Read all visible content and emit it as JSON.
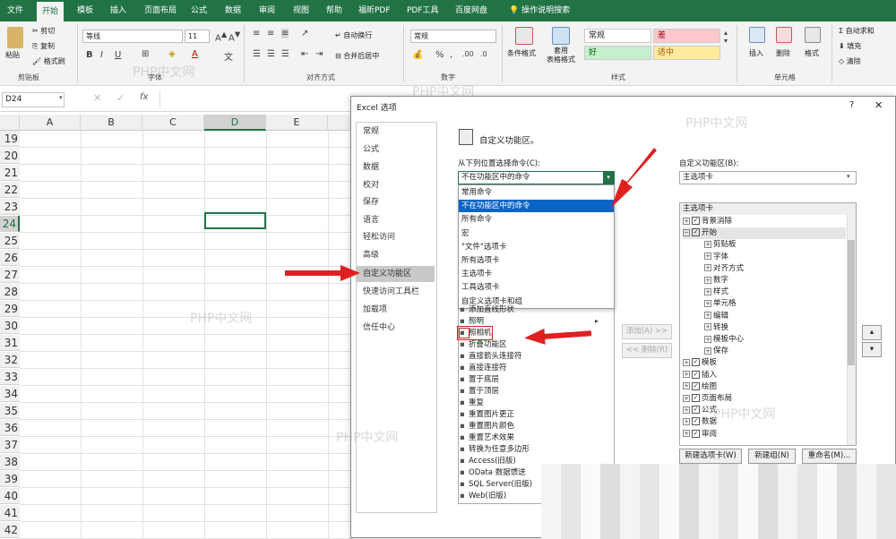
{
  "tabs": [
    "文件",
    "开始",
    "模板",
    "插入",
    "页面布局",
    "公式",
    "数据",
    "审阅",
    "视图",
    "帮助",
    "福昕PDF",
    "PDF工具",
    "百度网盘",
    "操作说明搜索"
  ],
  "ribbon": {
    "clipboard": {
      "paste": "粘贴",
      "cut": "剪切",
      "copy": "复制",
      "format_painter": "格式刷",
      "label": "剪贴板"
    },
    "font": {
      "name": "等线",
      "size": "11",
      "label": "字体"
    },
    "alignment": {
      "wrap": "自动换行",
      "merge": "合并后居中",
      "label": "对齐方式"
    },
    "number": {
      "format": "常规",
      "label": "数字"
    },
    "styles": {
      "cond": "条件格式",
      "table": "套用\n表格格式",
      "normal": "常规",
      "bad": "差",
      "good": "好",
      "neutral": "适中",
      "label": "样式"
    },
    "cells": {
      "insert": "插入",
      "delete": "删除",
      "format": "格式",
      "label": "单元格"
    },
    "editing": {
      "autosum": "自动求和",
      "fill": "填充",
      "clear": "清除"
    }
  },
  "formula_bar": {
    "namebox": "D24",
    "fx": "fx"
  },
  "grid": {
    "columns": [
      "A",
      "B",
      "C",
      "D",
      "E"
    ],
    "rows": [
      "19",
      "20",
      "21",
      "22",
      "23",
      "24",
      "25",
      "26",
      "27",
      "28",
      "29",
      "30",
      "31",
      "32",
      "33",
      "34",
      "35",
      "36",
      "37",
      "38",
      "39",
      "40",
      "41",
      "42"
    ]
  },
  "dialog": {
    "title": "Excel 选项",
    "help": "?",
    "close": "✕",
    "nav": [
      "常规",
      "公式",
      "数据",
      "校对",
      "保存",
      "语言",
      "轻松访问",
      "高级",
      "自定义功能区",
      "快速访问工具栏",
      "加载项",
      "信任中心"
    ],
    "heading": "自定义功能区。",
    "choose_label": "从下列位置选择命令(C):",
    "choose_value": "不在功能区中的命令",
    "dropdown_options": [
      "常用命令",
      "不在功能区中的命令",
      "所有命令",
      "宏",
      "\"文件\"选项卡",
      "所有选项卡",
      "主选项卡",
      "工具选项卡",
      "自定义选项卡和组"
    ],
    "commands": [
      "添加直线形状",
      "照明",
      "照相机",
      "折叠功能区",
      "直接箭头连接符",
      "直接连接符",
      "置于底层",
      "置于顶层",
      "重复",
      "重置图片更正",
      "重置图片颜色",
      "重置艺术效果",
      "转换为任意多边形",
      "Access(旧版)",
      "OData 数据馈送",
      "SQL Server(旧版)",
      "Web(旧版)"
    ],
    "add_btn": "添加(A) >>",
    "remove_btn": "<< 删除(R)",
    "custom_label": "自定义功能区(B):",
    "custom_value": "主选项卡",
    "tree_header": "主选项卡",
    "tree": [
      {
        "label": "背景消除",
        "level": 0,
        "pm": "+",
        "cb": true
      },
      {
        "label": "开始",
        "level": 0,
        "pm": "−",
        "cb": true
      },
      {
        "label": "剪贴板",
        "level": 1
      },
      {
        "label": "字体",
        "level": 1
      },
      {
        "label": "对齐方式",
        "level": 1
      },
      {
        "label": "数字",
        "level": 1
      },
      {
        "label": "样式",
        "level": 1
      },
      {
        "label": "单元格",
        "level": 1
      },
      {
        "label": "编辑",
        "level": 1
      },
      {
        "label": "转换",
        "level": 1
      },
      {
        "label": "模板中心",
        "level": 1
      },
      {
        "label": "保存",
        "level": 1
      },
      {
        "label": "模板",
        "level": 0,
        "pm": "+",
        "cb": true
      },
      {
        "label": "插入",
        "level": 0,
        "pm": "+",
        "cb": true
      },
      {
        "label": "绘图",
        "level": 0,
        "pm": "+",
        "cb": true
      },
      {
        "label": "页面布局",
        "level": 0,
        "pm": "+",
        "cb": true
      },
      {
        "label": "公式",
        "level": 0,
        "pm": "+",
        "cb": true
      },
      {
        "label": "数据",
        "level": 0,
        "pm": "+",
        "cb": true
      },
      {
        "label": "审阅",
        "level": 0,
        "pm": "+",
        "cb": true
      }
    ],
    "new_tab": "新建选项卡(W)",
    "new_group": "新建组(N)",
    "rename": "重命名(M)..."
  },
  "watermarks": [
    "PHP中文网",
    "PHP中文网",
    "PHP中文网",
    "PHP中文网",
    "PHP中文网",
    "PHP中文网"
  ],
  "colors": {
    "excel_green": "#217346",
    "arrow_red": "#e02020",
    "selected_blue": "#0a64c8"
  }
}
